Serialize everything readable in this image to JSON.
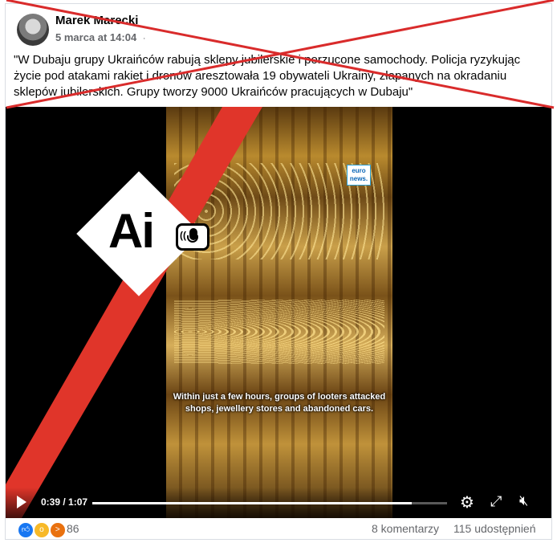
{
  "post": {
    "author": "Marek Marecki",
    "date": "5 marca at 14:04",
    "privacy_glyph": "·",
    "text": "\"W Dubaju grupy Ukraińców rabują sklepy jubilerskie i porzucone samochody. Policja ryzykując życie pod atakami rakiet i dronów aresztowała 19 obywateli Ukrainy, złapanych na okradaniu sklepów jubilerskich. Grupy tworzy 9000 Ukraińców pracujących w Dubaju\""
  },
  "video": {
    "subtitle": "Within just a few hours, groups of looters attacked shops, jewellery stores and abandoned cars.",
    "logo": "euro news.",
    "ai_badge": "Ai",
    "current_time": "0:39",
    "duration": "1:07",
    "progress": 0.9
  },
  "icons": [
    "play-icon",
    "gear-icon",
    "fullscreen-icon",
    "volume-muted-icon",
    "microphone-icon",
    "like-icon",
    "wow-icon",
    "angry-icon"
  ],
  "footer": {
    "reaction_count": "86",
    "comments": "8 komentarzy",
    "shares": "115 udostępnień"
  },
  "colors": {
    "cross": "#d92b2b",
    "sash": "#e0352a",
    "link": "#385898"
  }
}
